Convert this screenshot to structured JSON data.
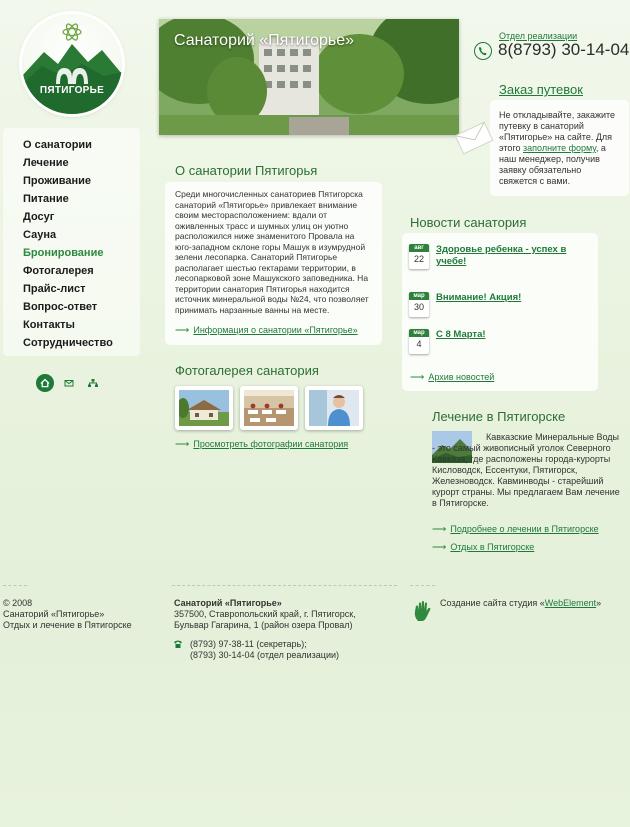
{
  "logo": {
    "text": "ПЯТИГОРЬЕ"
  },
  "nav": {
    "items": [
      {
        "label": "О санатории"
      },
      {
        "label": "Лечение"
      },
      {
        "label": "Проживание"
      },
      {
        "label": "Питание"
      },
      {
        "label": "Досуг"
      },
      {
        "label": "Сауна"
      },
      {
        "label": "Бронирование",
        "active": true
      },
      {
        "label": "Фотогалерея"
      },
      {
        "label": "Прайс-лист"
      },
      {
        "label": "Вопрос-ответ"
      },
      {
        "label": "Контакты"
      },
      {
        "label": "Сотрудничество"
      }
    ]
  },
  "header": {
    "title": "Санаторий «Пятигорье»"
  },
  "contacts": {
    "sales_label": "Отдел реализации",
    "phone": "8(8793) 30-14-04"
  },
  "order": {
    "title": "Заказ путевок",
    "text_before": "Не откладывайте, закажите путевку в санаторий «Пятигорье» на сайте. Для этого ",
    "link": "заполните форму",
    "text_after": ", а наш менеджер, получив заявку обязательно свяжется с вами."
  },
  "about": {
    "title": "О санатории Пятигорья",
    "text": "Среди многочисленных санаториев Пятигорска санаторий «Пятигорье» привлекает внимание своим месторасположением: вдали от оживленных трасс и шумных улиц он уютно расположился ниже знаменитого Провала на юго-западном склоне горы Машук в изумрудной зелени лесопарка. Санаторий Пятигорье располагает шестью гектарами территории, в лесопарковой зоне Машукского заповедника. На территории санатория Пятигорья находится источник минеральной воды №24, что позволяет принимать нарзанные ванны на месте.",
    "more_link": "Информация о санатории «Пятигорье»"
  },
  "news": {
    "title": "Новости санатория",
    "items": [
      {
        "month": "авг",
        "day": "22",
        "title": "Здоровье ребенка - успех в учебе!"
      },
      {
        "month": "мар",
        "day": "30",
        "title": "Внимание! Акция!"
      },
      {
        "month": "мар",
        "day": "4",
        "title": "С 8 Марта!"
      }
    ],
    "archive_link": "Архив новостей"
  },
  "gallery": {
    "title": "Фотогалерея санатория",
    "link": "Просмотреть фотографии санатория"
  },
  "treatment": {
    "title": "Лечение в Пятигорске",
    "text": "Кавказские Минеральные Воды - это самый живописный уголок Северного Кавказа, где расположены города-курорты Кисловодск, Ессентуки, Пятигорск, Железноводск. Кавминводы - старейший курорт страны. Мы предлагаем Вам лечение в Пятигорске.",
    "more_link": "Подробнее о лечении в Пятигорске",
    "rest_link": "Отдых в Пятигорске"
  },
  "footer": {
    "copyright_year": "© 2008",
    "copyright_name": "Санаторий «Пятигорье»",
    "copyright_desc": "Отдых и лечение в Пятигорске",
    "org_name": "Санаторий «Пятигорье»",
    "address_line1": "357500, Ставропольский край, г. Пятигорск,",
    "address_line2": "Бульвар Гагарина, 1 (район озера Провал)",
    "phone1": "(8793) 97-38-11 (секретарь);",
    "phone2": "(8793) 30-14-04 (отдел реализации)",
    "studio_text": "Создание сайта студия «",
    "studio_link": "WebElement",
    "studio_end": "»"
  },
  "colors": {
    "accent": "#1f7a3a",
    "active_menu": "#2c8a3e",
    "heading": "#2d6e35"
  }
}
